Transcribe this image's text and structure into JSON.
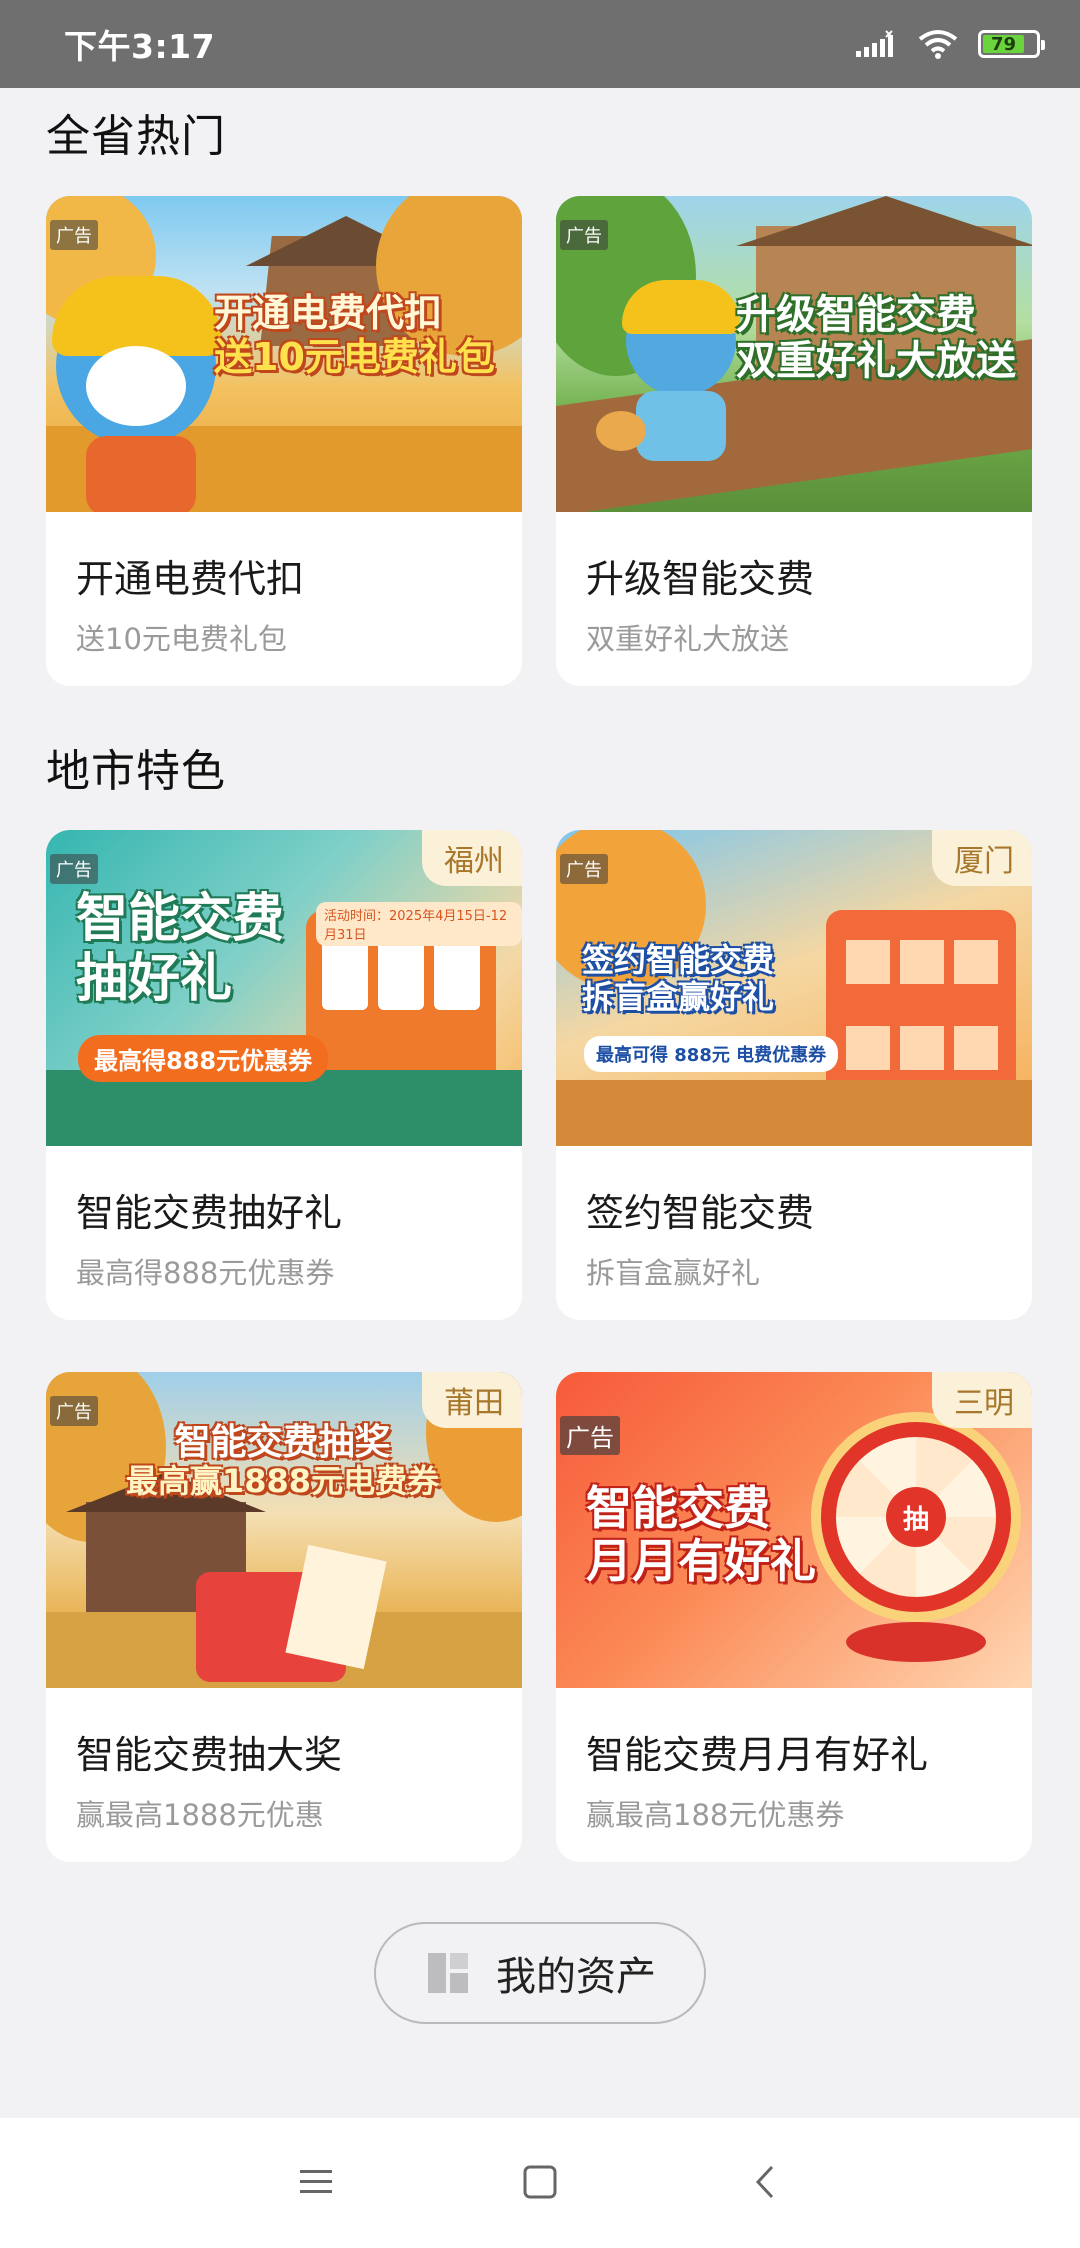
{
  "status": {
    "time": "下午3:17",
    "battery": "79",
    "battery_level": 0.79
  },
  "sections": {
    "province_title": "全省热门",
    "city_title": "地市特色"
  },
  "cards": [
    {
      "ad": "广告",
      "banner_line1": "开通电费代扣",
      "banner_line2": "送10元电费礼包",
      "title": "开通电费代扣",
      "subtitle": "送10元电费礼包"
    },
    {
      "ad": "广告",
      "banner_line1": "升级智能交费",
      "banner_line2": "双重好礼大放送",
      "title": "升级智能交费",
      "subtitle": "双重好礼大放送"
    },
    {
      "ad": "广告",
      "city": "福州",
      "banner_line1": "智能交费",
      "banner_line2": "抽好礼",
      "banner_badge": "最高得888元优惠券",
      "banner_date": "活动时间：2025年4月15日-12月31日",
      "title": "智能交费抽好礼",
      "subtitle": "最高得888元优惠券"
    },
    {
      "ad": "广告",
      "city": "厦门",
      "banner_line1": "签约智能交费",
      "banner_line2": "拆盲盒赢好礼",
      "banner_badge": "最高可得 888元 电费优惠券",
      "title": "签约智能交费",
      "subtitle": "拆盲盒赢好礼"
    },
    {
      "ad": "广告",
      "city": "莆田",
      "banner_line1": "智能交费抽奖",
      "banner_line2": "最高赢1888元电费券",
      "title": "智能交费抽大奖",
      "subtitle": "赢最高1888元优惠"
    },
    {
      "ad": "广告",
      "city": "三明",
      "banner_line1": "智能交费",
      "banner_line2": "月月有好礼",
      "banner_wheel_center": "抽",
      "title": "智能交费月月有好礼",
      "subtitle": "赢最高188元优惠券"
    }
  ],
  "assets_button": {
    "label": "我的资产",
    "icon": "assets-icon"
  },
  "nav": {
    "menu": "menu-icon",
    "home": "home-icon",
    "back": "back-icon"
  }
}
